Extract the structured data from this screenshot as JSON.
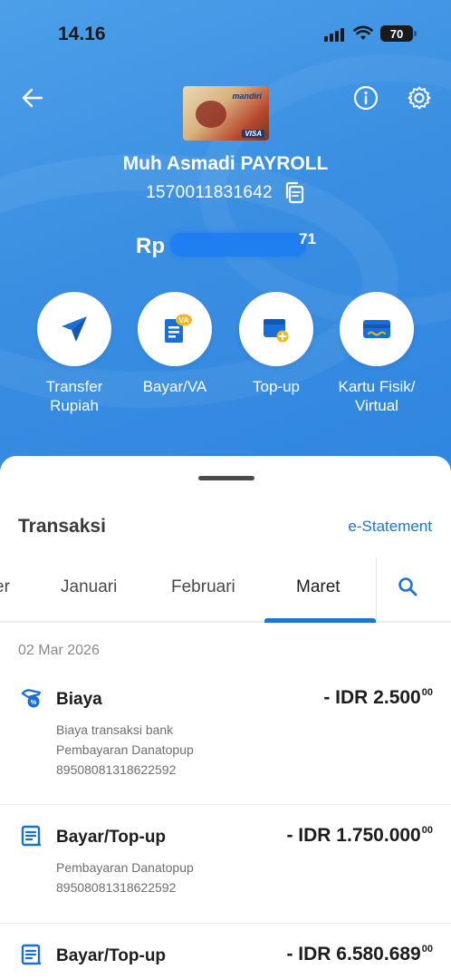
{
  "status_bar": {
    "time": "14.16",
    "battery": "70"
  },
  "account": {
    "name": "Muh Asmadi PAYROLL",
    "number": "1570011831642",
    "balance_prefix": "Rp",
    "balance_suffix": "71",
    "card_brand": "mandiri",
    "card_network": "VISA"
  },
  "actions": [
    {
      "label": "Transfer\nRupiah",
      "icon": "send-icon"
    },
    {
      "label": "Bayar/VA",
      "icon": "bill-va-icon",
      "badge": "VA"
    },
    {
      "label": "Top-up",
      "icon": "wallet-plus-icon"
    },
    {
      "label": "Kartu Fisik/\nVirtual",
      "icon": "card-icon"
    }
  ],
  "sheet": {
    "title": "Transaksi",
    "estatement": "e-Statement",
    "tabs": [
      "er",
      "Januari",
      "Februari",
      "Maret"
    ],
    "active_tab": "Maret",
    "date_header": "02 Mar 2026"
  },
  "transactions": [
    {
      "title": "Biaya",
      "amount": "- IDR 2.500",
      "cents": "00",
      "lines": [
        "Biaya transaksi bank",
        "Pembayaran Danatopup",
        "89508081318622592"
      ],
      "icon": "fee-icon"
    },
    {
      "title": "Bayar/Top-up",
      "amount": "- IDR 1.750.000",
      "cents": "00",
      "lines": [
        "Pembayaran Danatopup",
        "89508081318622592"
      ],
      "icon": "receipt-icon"
    },
    {
      "title": "Bayar/Top-up",
      "amount": "- IDR 6.580.689",
      "cents": "00",
      "lines": [],
      "icon": "receipt-icon"
    }
  ],
  "colors": {
    "hero_blue": "#3a8fe2",
    "accent_blue": "#1e73d8",
    "icon_blue": "#1a6fd6"
  }
}
